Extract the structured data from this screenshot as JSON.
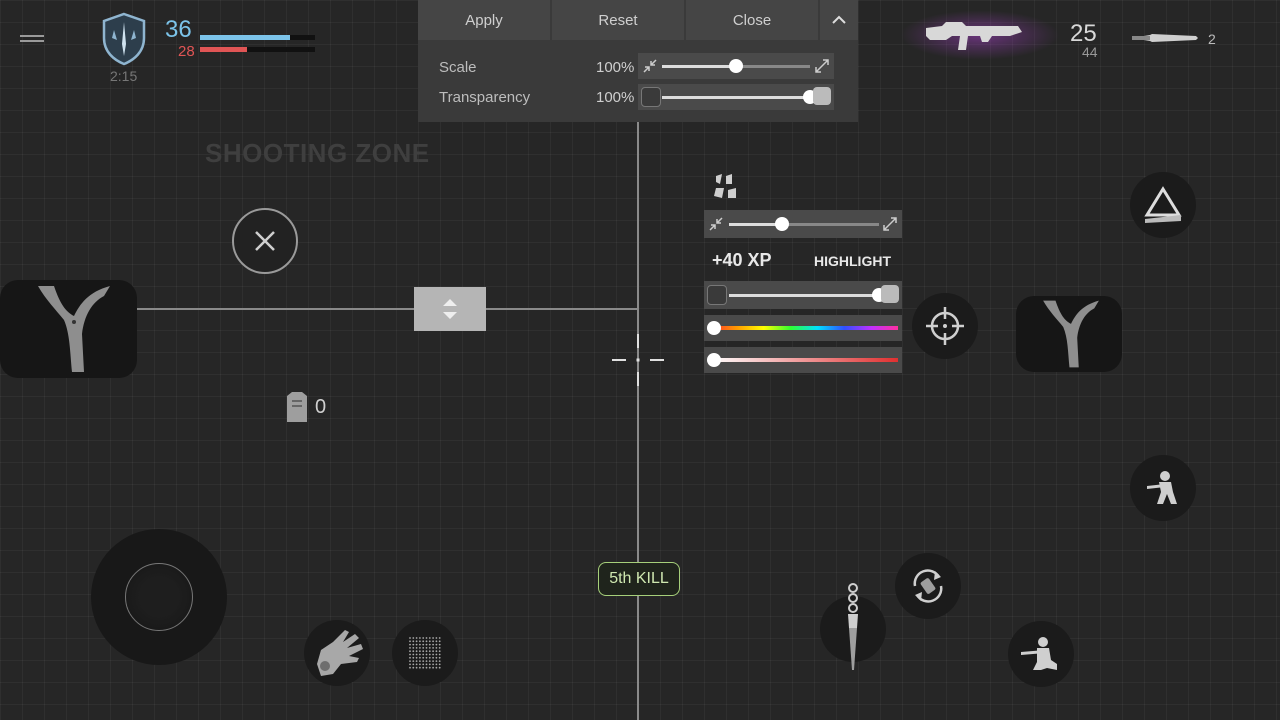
{
  "hud": {
    "health": "36",
    "armor": "28",
    "health_fraction": 0.78,
    "armor_fraction": 0.41,
    "timer": "2:15",
    "icons": {
      "menu": "hamburger-icon",
      "rank": "shield-icon"
    }
  },
  "panel": {
    "apply_label": "Apply",
    "reset_label": "Reset",
    "close_label": "Close",
    "scale_label": "Scale",
    "scale_value": "100%",
    "scale_level": 0.5,
    "transparency_label": "Transparency",
    "transparency_value": "100%",
    "transparency_level": 1.0
  },
  "weapon": {
    "ammo": "25",
    "reserve": "44",
    "knife_count": "2",
    "icons": {
      "primary": "smg-icon",
      "secondary": "knife-icon"
    }
  },
  "zone_label": "SHOOTING ZONE",
  "armor_pickup_count": "0",
  "kill_label": "5th KILL",
  "highlight_panel": {
    "xp_label": "+40 XP",
    "highlight_label": "HIGHLIGHT",
    "size_level": 0.35,
    "opacity_level": 1.0,
    "hue_level": 0.0,
    "saturation_level": 0.0
  },
  "colors": {
    "health": "#7cc4ea",
    "armor": "#e05555",
    "kill_border": "#a6d07a",
    "weapon_glow": "#a040c0"
  }
}
